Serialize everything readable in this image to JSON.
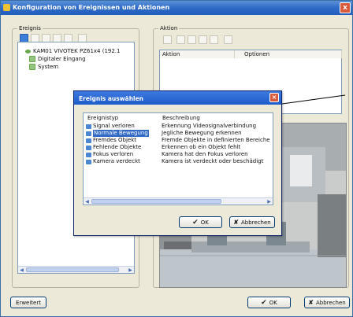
{
  "window": {
    "title": "Konfiguration von Ereignissen und Aktionen",
    "close_glyph": "x"
  },
  "ereignis_group": {
    "label": "Ereignis",
    "tree": [
      {
        "label": "KAM01 VIVOTEK PZ61x4 (192.1",
        "icon": "camera-icon"
      },
      {
        "label": "Digitaler Eingang",
        "icon": "folder-icon"
      },
      {
        "label": "System",
        "icon": "folder-icon"
      }
    ]
  },
  "aktion_group": {
    "label": "Aktion",
    "columns": [
      "Aktion",
      "Optionen"
    ]
  },
  "footer": {
    "erweitert_label": "Erweitert",
    "ok_label": "OK",
    "abbrechen_label": "Abbrechen"
  },
  "dialog": {
    "title": "Ereignis auswählen",
    "columns": [
      "Ereignistyp",
      "Beschreibung"
    ],
    "rows": [
      {
        "type": "Signal verloren",
        "desc": "Erkennung Videosignalverbindung",
        "selected": false
      },
      {
        "type": "Normale Bewegung",
        "desc": "Jegliche Bewegung erkennen",
        "selected": true
      },
      {
        "type": "Fremdes Objekt",
        "desc": "Fremde Objekte in definierten Bereiche",
        "selected": false
      },
      {
        "type": "Fehlende Objekte",
        "desc": "Erkennen ob ein Objekt fehlt",
        "selected": false
      },
      {
        "type": "Fokus verloren",
        "desc": "Kamera hat den Fokus verloren",
        "selected": false
      },
      {
        "type": "Kamera verdeckt",
        "desc": "Kamera ist verdeckt oder beschädigt",
        "selected": false
      }
    ],
    "ok_label": "OK",
    "abbrechen_label": "Abbrechen"
  },
  "colors": {
    "title_bar": "#2f6bc7",
    "selection": "#316ac5",
    "close_button": "#d9593b"
  }
}
